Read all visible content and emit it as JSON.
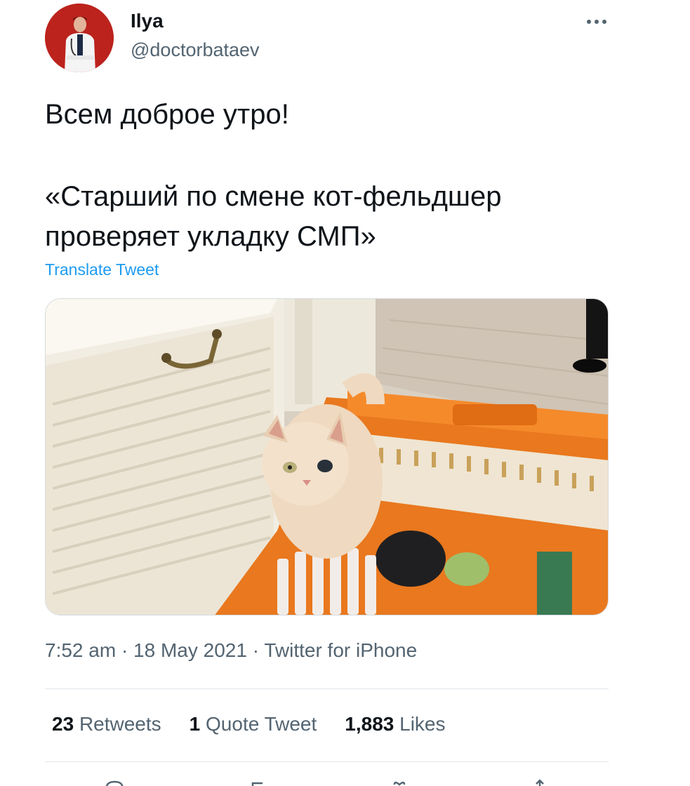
{
  "author": {
    "display_name": "Ilya",
    "handle": "@doctorbataev",
    "avatar_bg": "#c4261f"
  },
  "more_icon": "more-horizontal-icon",
  "tweet": {
    "line1": "Всем доброе утро!",
    "line2": "«Старший по смене кот-фельдшер проверяет укладку СМП»",
    "translate_label": "Translate Tweet"
  },
  "meta": {
    "timestamp": "7:52 am · 18 May 2021 · Twitter for iPhone"
  },
  "stats": {
    "retweets_count": "23",
    "retweets_label": "Retweets",
    "quotes_count": "1",
    "quotes_label": "Quote Tweet",
    "likes_count": "1,883",
    "likes_label": "Likes"
  },
  "actions": [
    "reply-icon",
    "retweet-icon",
    "like-icon",
    "share-icon"
  ],
  "colors": {
    "link": "#1d9bf0",
    "secondary_text": "#536471",
    "primary_text": "#0f1419",
    "divider": "#e1e6ea"
  }
}
